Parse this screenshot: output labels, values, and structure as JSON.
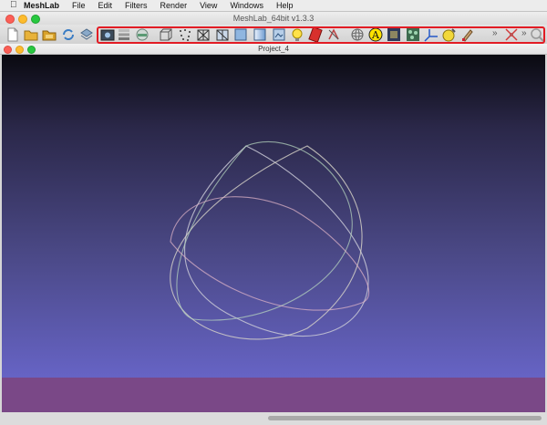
{
  "menubar": {
    "apple_icon": "apple-logo-icon",
    "items": [
      "MeshLab",
      "File",
      "Edit",
      "Filters",
      "Render",
      "View",
      "Windows",
      "Help"
    ]
  },
  "window": {
    "title": "MeshLab_64bit v1.3.3"
  },
  "subwindow": {
    "title": "Project_4"
  },
  "toolbar": {
    "left_icons": [
      "new-document-icon",
      "open-folder-icon",
      "open-project-icon",
      "reload-icon",
      "save-icon"
    ],
    "highlighted_icons": [
      "snapshot-icon",
      "layers-icon",
      "glasses-icon",
      "bbox-icon",
      "points-icon",
      "wireframe-icon",
      "hidden-lines-icon",
      "flat-icon",
      "smooth-icon",
      "texture-icon",
      "light-icon",
      "double-light-icon",
      "back-face-icon",
      "trackball-icon",
      "annotate-icon",
      "info-icon",
      "color-icon",
      "axis-icon",
      "gold-icon",
      "paint-icon",
      "chevron-icon",
      "select-edges-icon",
      "chevron-icon",
      "zoom-icon"
    ],
    "highlight_color": "#e21c24"
  },
  "viewport": {
    "background_top": "#0a0a10",
    "background_bottom": "#6e6bd6",
    "floor_color": "#7a4887"
  }
}
